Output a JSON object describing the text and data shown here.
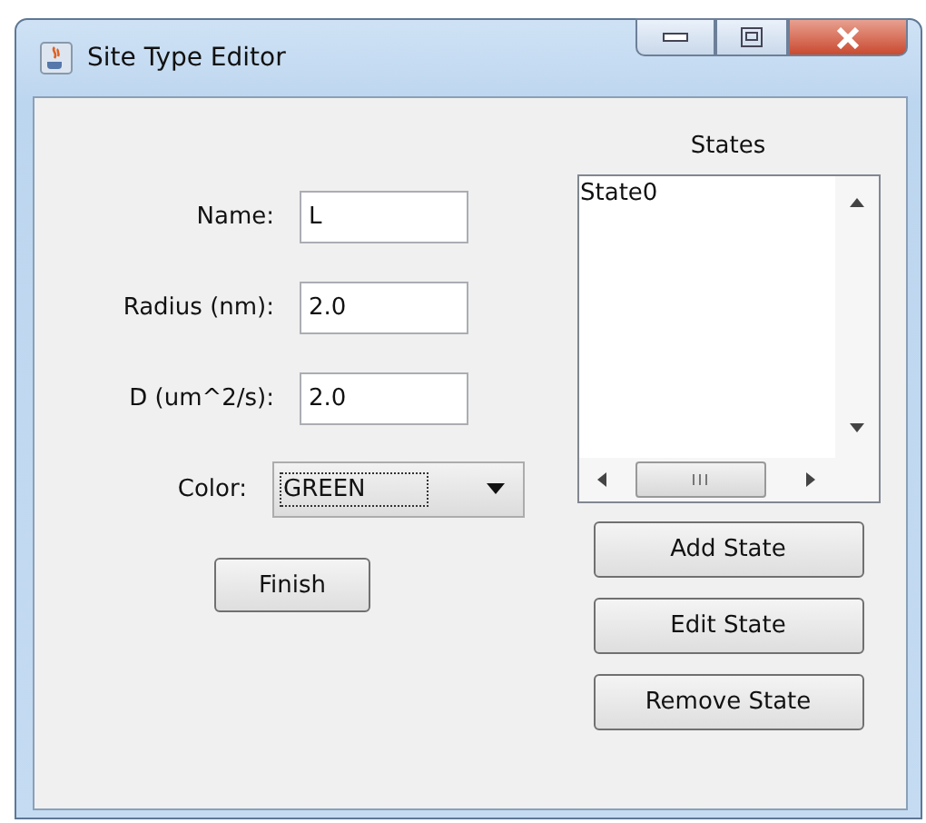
{
  "window": {
    "title": "Site Type Editor"
  },
  "fields": [
    {
      "label": "Name:",
      "value": "L"
    },
    {
      "label": "Radius (nm):",
      "value": "2.0"
    },
    {
      "label": "D (um^2/s):",
      "value": "2.0"
    }
  ],
  "color": {
    "label": "Color:",
    "value": "GREEN"
  },
  "finish_button": "Finish",
  "states": {
    "title": "States",
    "items": [
      {
        "label": "State0",
        "selected": false
      }
    ]
  },
  "state_buttons": [
    "Add State",
    "Edit State",
    "Remove State"
  ]
}
